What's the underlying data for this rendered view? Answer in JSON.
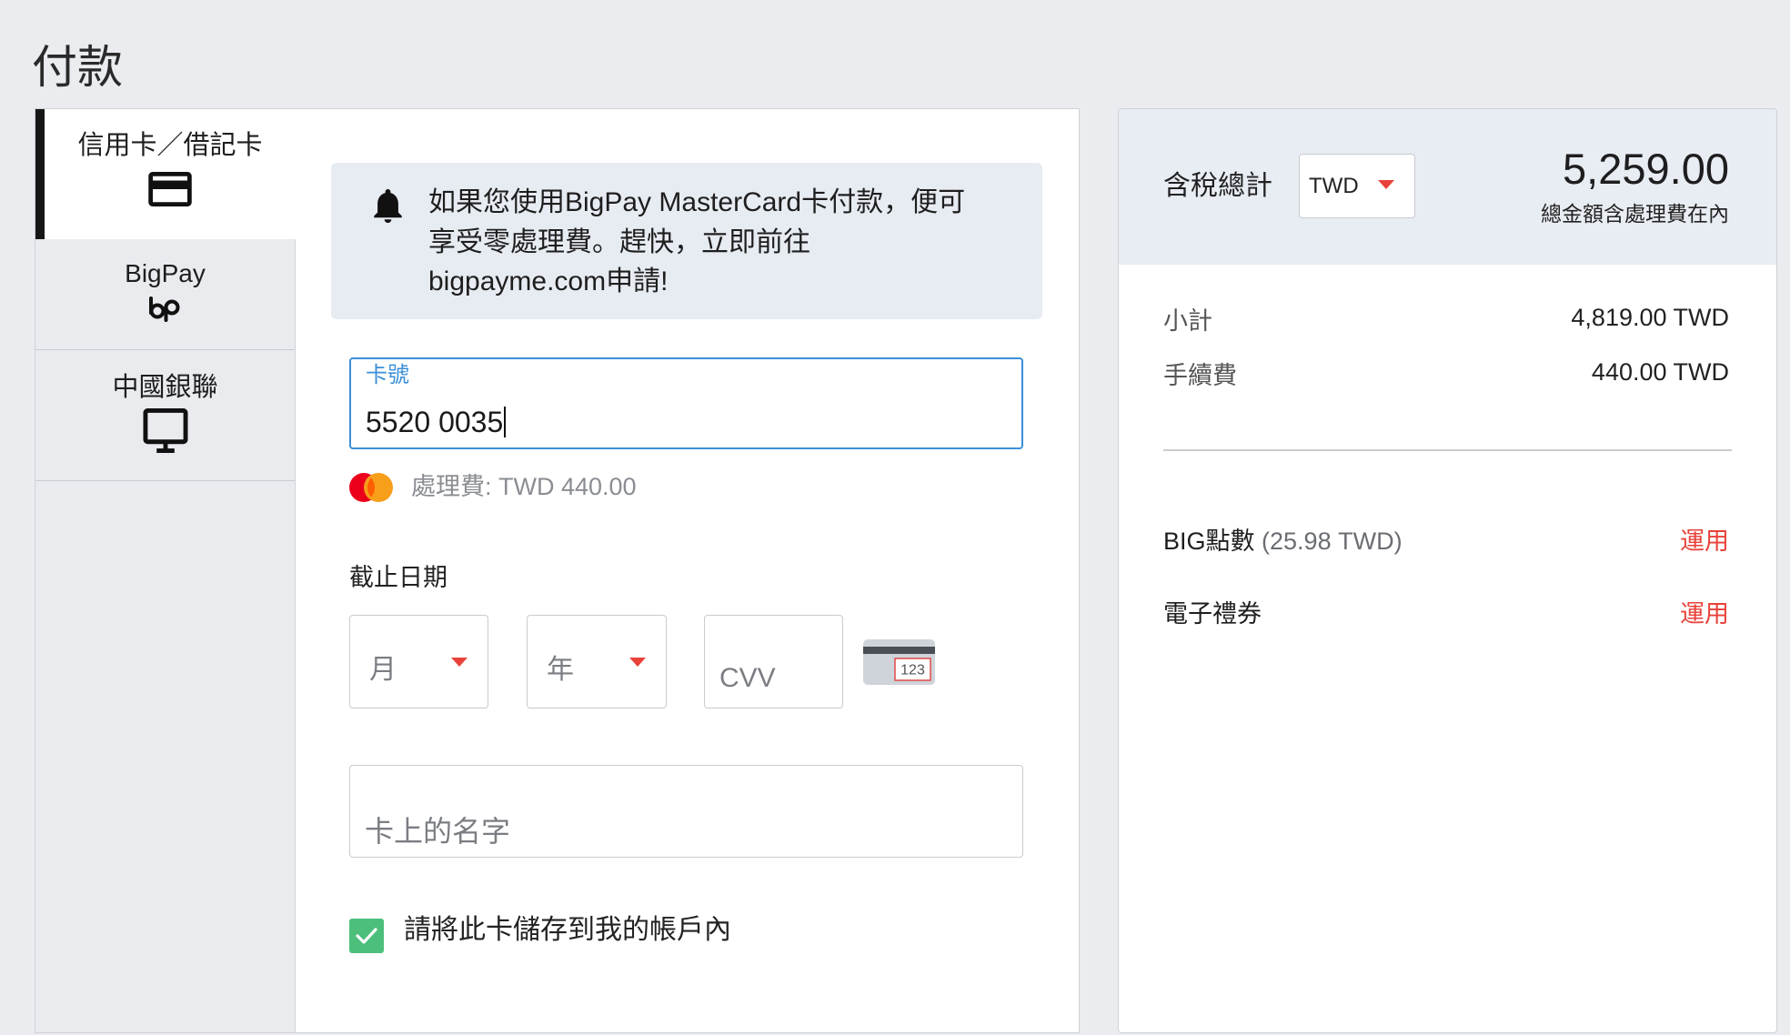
{
  "page": {
    "title": "付款"
  },
  "payment_methods": [
    {
      "label": "信用卡／借記卡",
      "icon": "credit-card-icon",
      "active": true
    },
    {
      "label": "BigPay",
      "icon": "bigpay-logo-icon",
      "active": false
    },
    {
      "label": "中國銀聯",
      "icon": "monitor-icon",
      "active": false
    }
  ],
  "notice": {
    "icon": "bell-icon",
    "lines": [
      "如果您使用BigPay MasterCard卡付款，便可",
      "享受零處理費。趕快，立即前往",
      "bigpayme.com申請!"
    ]
  },
  "card_form": {
    "card_number": {
      "label": "卡號",
      "value": "5520 0035",
      "focused": true
    },
    "processing_fee": {
      "brand_icon": "mastercard-icon",
      "text": "處理費: TWD 440.00"
    },
    "expiry": {
      "label": "截止日期",
      "month": {
        "placeholder": "月"
      },
      "year": {
        "placeholder": "年"
      }
    },
    "cvv": {
      "placeholder": "CVV",
      "hint_icon": "card-back-cvv-icon",
      "hint_text": "123"
    },
    "cardholder_name": {
      "placeholder": "卡上的名字"
    },
    "save_card": {
      "checked": true,
      "label": "請將此卡儲存到我的帳戶內"
    }
  },
  "summary": {
    "total": {
      "label": "含稅總計",
      "currency": "TWD",
      "amount": "5,259.00",
      "note": "總金額含處理費在內"
    },
    "lines": [
      {
        "label": "小計",
        "value": "4,819.00 TWD"
      },
      {
        "label": "手續費",
        "value": "440.00 TWD"
      }
    ],
    "discounts": [
      {
        "label": "BIG點數",
        "detail": "(25.98 TWD)",
        "action": "運用"
      },
      {
        "label": "電子禮券",
        "action": "運用"
      }
    ]
  },
  "colors": {
    "accent_red": "#e8423a",
    "focus_blue": "#3b8fd8",
    "check_green": "#4cbf7c"
  }
}
